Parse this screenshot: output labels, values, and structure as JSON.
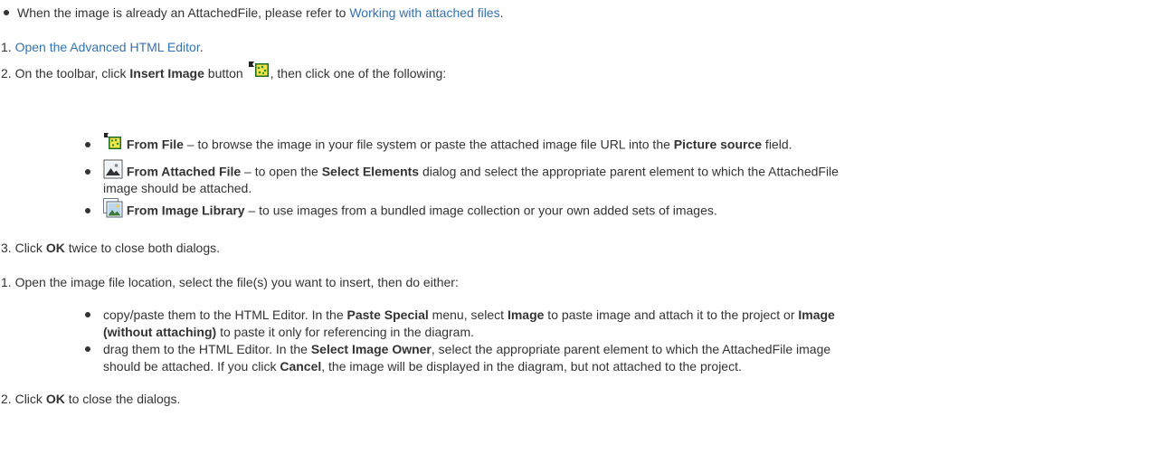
{
  "intro": {
    "prefix": "When the image is already an AttachedFile, please refer to ",
    "link": "Working with attached files",
    "suffix": "."
  },
  "section_a": {
    "step1": {
      "num": "1.",
      "link": "Open the Advanced HTML Editor",
      "suffix": "."
    },
    "step2": {
      "num": "2.",
      "pre": "On the toolbar, click ",
      "bold": "Insert Image",
      "mid": " button ",
      "post": ", then click one of the following:",
      "button_icon": "insert-image-icon"
    },
    "options": [
      {
        "icon": "insert-image-from-file-icon",
        "title": "From File",
        "t1": " – to browse the image in your file system or paste the attached image file URL into the ",
        "b1": "Picture source",
        "t2": " field."
      },
      {
        "icon": "attached-file-image-icon",
        "title": "From Attached File",
        "t1": " – to open the ",
        "b1": "Select Elements",
        "t2": " dialog and select the appropriate parent element to which the AttachedFile",
        "t3": "image should be attached."
      },
      {
        "icon": "image-library-icon",
        "title": "From Image Library",
        "t1": " – to use images from a bundled image collection or your own added sets of images."
      }
    ],
    "step3": {
      "num": "3.",
      "pre": "Click ",
      "bold": "OK",
      "post": " twice to close both dialogs."
    }
  },
  "section_b": {
    "step1": {
      "num": "1.",
      "text": "Open the image file location, select the file(s) you want to insert, then do either:"
    },
    "bullets": [
      {
        "t1": "copy/paste them to the HTML Editor. In the ",
        "b1": "Paste Special",
        "t2": " menu, select ",
        "b2": "Image",
        "t3": " to paste image and attach it to the project or ",
        "b3": "Image",
        "b4": "(without attaching)",
        "t4": " to paste it only for referencing in the diagram."
      },
      {
        "t1": "drag them to the HTML Editor. In the ",
        "b1": "Select Image Owner",
        "t2": ", select the appropriate parent element to which the AttachedFile image",
        "t3": "should be attached. If you click ",
        "b2": "Cancel",
        "t4": ", the image will be displayed in the diagram, but not attached to the project."
      }
    ],
    "step2": {
      "num": "2.",
      "pre": "Click ",
      "bold": "OK",
      "post": " to close the dialogs."
    }
  },
  "colors": {
    "link": "#3572b0",
    "text": "#333333"
  }
}
